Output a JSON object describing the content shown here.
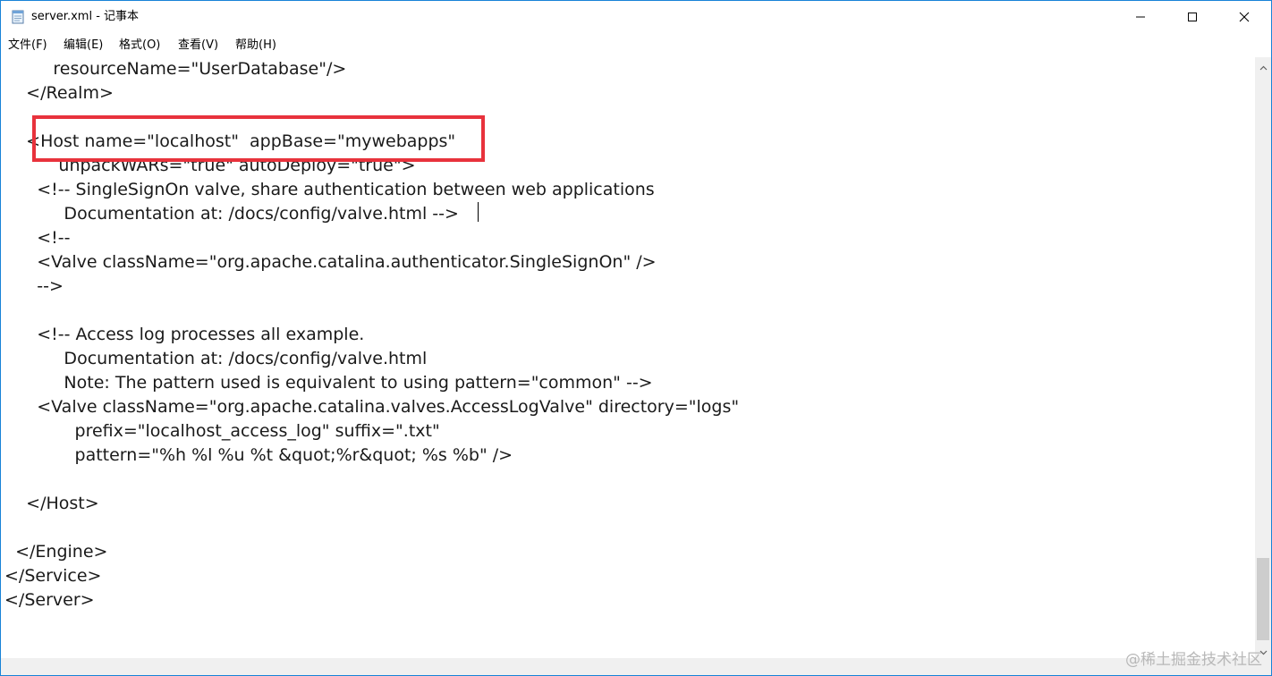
{
  "window": {
    "title": "server.xml - 记事本",
    "icon": "notepad-icon"
  },
  "titlebar_buttons": {
    "minimize_icon": "minimize-icon",
    "maximize_icon": "maximize-icon",
    "close_icon": "close-icon"
  },
  "menu": {
    "items": [
      {
        "label": "文件(F)"
      },
      {
        "label": "编辑(E)"
      },
      {
        "label": "格式(O)"
      },
      {
        "label": "查看(V)"
      },
      {
        "label": "帮助(H)"
      }
    ]
  },
  "editor": {
    "lines": [
      "         resourceName=\"UserDatabase\"/>",
      "    </Realm>",
      "",
      "    <Host name=\"localhost\"  appBase=\"mywebapps\"",
      "          unpackWARs=\"true\" autoDeploy=\"true\">",
      "      <!-- SingleSignOn valve, share authentication between web applications",
      "           Documentation at: /docs/config/valve.html -->",
      "      <!--",
      "      <Valve className=\"org.apache.catalina.authenticator.SingleSignOn\" />",
      "      -->",
      "",
      "      <!-- Access log processes all example.",
      "           Documentation at: /docs/config/valve.html",
      "           Note: The pattern used is equivalent to using pattern=\"common\" -->",
      "      <Valve className=\"org.apache.catalina.valves.AccessLogValve\" directory=\"logs\"",
      "             prefix=\"localhost_access_log\" suffix=\".txt\"",
      "             pattern=\"%h %l %u %t &quot;%r&quot; %s %b\" />",
      "",
      "    </Host>",
      "",
      "  </Engine>",
      "</Service>",
      "</Server>"
    ]
  },
  "annotation": {
    "color": "#e8323c"
  },
  "watermark": {
    "text": "@稀土掘金技术社区"
  },
  "colors": {
    "window_border": "#1883d7",
    "scrollbar_track": "#f0f0f0",
    "scrollbar_thumb": "#cdcdcd"
  }
}
